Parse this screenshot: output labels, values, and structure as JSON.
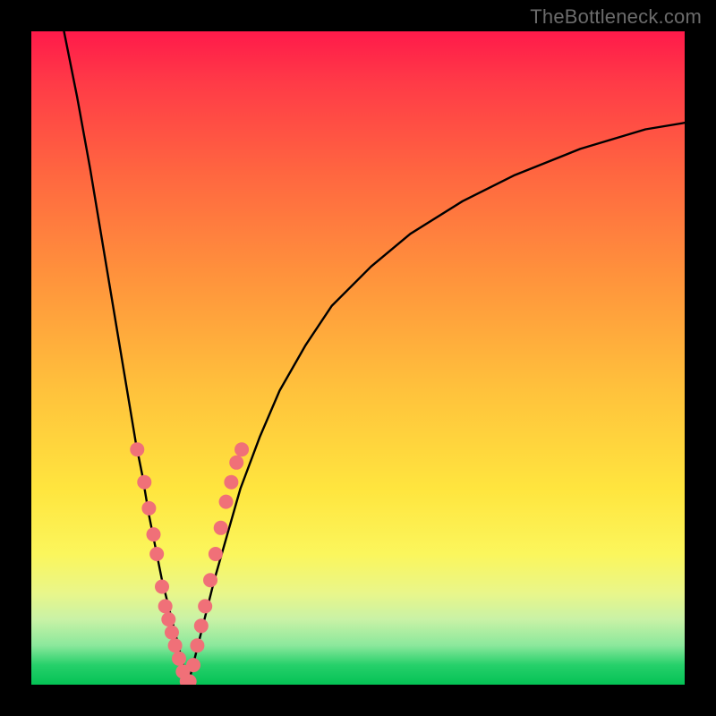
{
  "watermark": "TheBottleneck.com",
  "chart_data": {
    "type": "line",
    "title": "",
    "xlabel": "",
    "ylabel": "",
    "xlim": [
      0,
      100
    ],
    "ylim": [
      0,
      100
    ],
    "grid": false,
    "curve_left": {
      "x": [
        5,
        7,
        9,
        11,
        13,
        15,
        16,
        17,
        18,
        19,
        20,
        21,
        22,
        23,
        24
      ],
      "y": [
        100,
        90,
        79,
        67,
        55,
        43,
        37,
        32,
        26,
        21,
        16,
        12,
        8,
        4,
        0
      ]
    },
    "curve_right": {
      "x": [
        24,
        25,
        26,
        27,
        28,
        30,
        32,
        35,
        38,
        42,
        46,
        52,
        58,
        66,
        74,
        84,
        94,
        100
      ],
      "y": [
        0,
        4,
        8,
        12,
        16,
        23,
        30,
        38,
        45,
        52,
        58,
        64,
        69,
        74,
        78,
        82,
        85,
        86
      ]
    },
    "markers_left": {
      "x": [
        16.2,
        17.3,
        18.0,
        18.7,
        19.2,
        20.0,
        20.5,
        21.0,
        21.5,
        22.0,
        22.6,
        23.2,
        23.8
      ],
      "y": [
        36,
        31,
        27,
        23,
        20,
        15,
        12,
        10,
        8,
        6,
        4,
        2,
        0.5
      ]
    },
    "markers_right": {
      "x": [
        24.2,
        24.8,
        25.4,
        26.0,
        26.6,
        27.4,
        28.2,
        29.0,
        29.8,
        30.6,
        31.4,
        32.2
      ],
      "y": [
        0.5,
        3,
        6,
        9,
        12,
        16,
        20,
        24,
        28,
        31,
        34,
        36
      ]
    },
    "gradient_stops": [
      {
        "pos": 0.0,
        "color": "#ff1a4a"
      },
      {
        "pos": 0.08,
        "color": "#ff3b47"
      },
      {
        "pos": 0.22,
        "color": "#ff6740"
      },
      {
        "pos": 0.38,
        "color": "#ff943c"
      },
      {
        "pos": 0.55,
        "color": "#ffc23c"
      },
      {
        "pos": 0.7,
        "color": "#ffe53e"
      },
      {
        "pos": 0.8,
        "color": "#fbf65c"
      },
      {
        "pos": 0.86,
        "color": "#e9f68a"
      },
      {
        "pos": 0.9,
        "color": "#c9f2a6"
      },
      {
        "pos": 0.94,
        "color": "#8be89c"
      },
      {
        "pos": 0.97,
        "color": "#26d06a"
      },
      {
        "pos": 1.0,
        "color": "#04c255"
      }
    ],
    "marker_color": "#f07078",
    "curve_color": "#000000"
  }
}
